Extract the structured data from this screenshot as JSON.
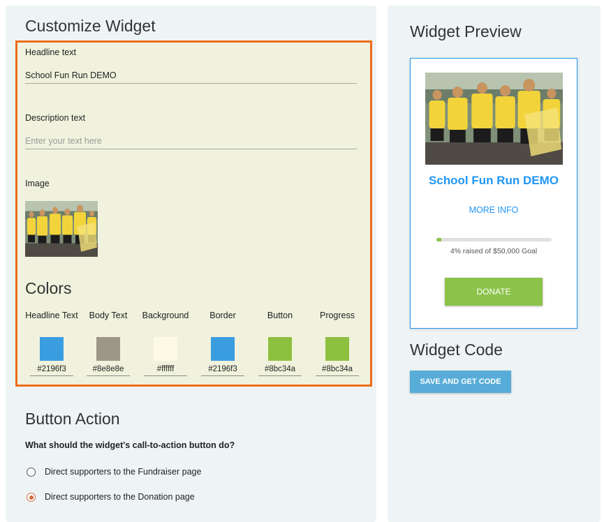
{
  "customize": {
    "title": "Customize Widget",
    "headline_label": "Headline text",
    "headline_value": "School Fun Run DEMO",
    "description_label": "Description text",
    "description_placeholder": "Enter your text here",
    "image_label": "Image"
  },
  "colors": {
    "title": "Colors",
    "items": [
      {
        "label": "Headline Text",
        "hex": "#2196f3",
        "swatch": "#3a9de0"
      },
      {
        "label": "Body Text",
        "hex": "#8e8e8e",
        "swatch": "#9c9787"
      },
      {
        "label": "Background",
        "hex": "#ffffff",
        "swatch": "#fcf9e6"
      },
      {
        "label": "Border",
        "hex": "#2196f3",
        "swatch": "#3a9de0"
      },
      {
        "label": "Button",
        "hex": "#8bc34a",
        "swatch": "#8dc03f"
      },
      {
        "label": "Progress",
        "hex": "#8bc34a",
        "swatch": "#8dc03f"
      }
    ]
  },
  "button_action": {
    "title": "Button Action",
    "question": "What should the widget's call-to-action button do?",
    "options": [
      {
        "label": "Direct supporters to the Fundraiser page",
        "selected": false
      },
      {
        "label": "Direct supporters to the Donation page",
        "selected": true
      }
    ]
  },
  "preview": {
    "title": "Widget Preview",
    "headline": "School Fun Run DEMO",
    "more_info": "MORE INFO",
    "raised_text": "4% raised of $50,000 Goal",
    "progress_fraction": 0.04,
    "donate_label": "DONATE"
  },
  "code": {
    "title": "Widget Code",
    "save_label": "SAVE AND GET CODE"
  },
  "theme": {
    "accent_orange": "#ee6c1a",
    "primary_blue": "#2196f3",
    "green": "#8bc34a",
    "save_blue": "#57acd8"
  }
}
